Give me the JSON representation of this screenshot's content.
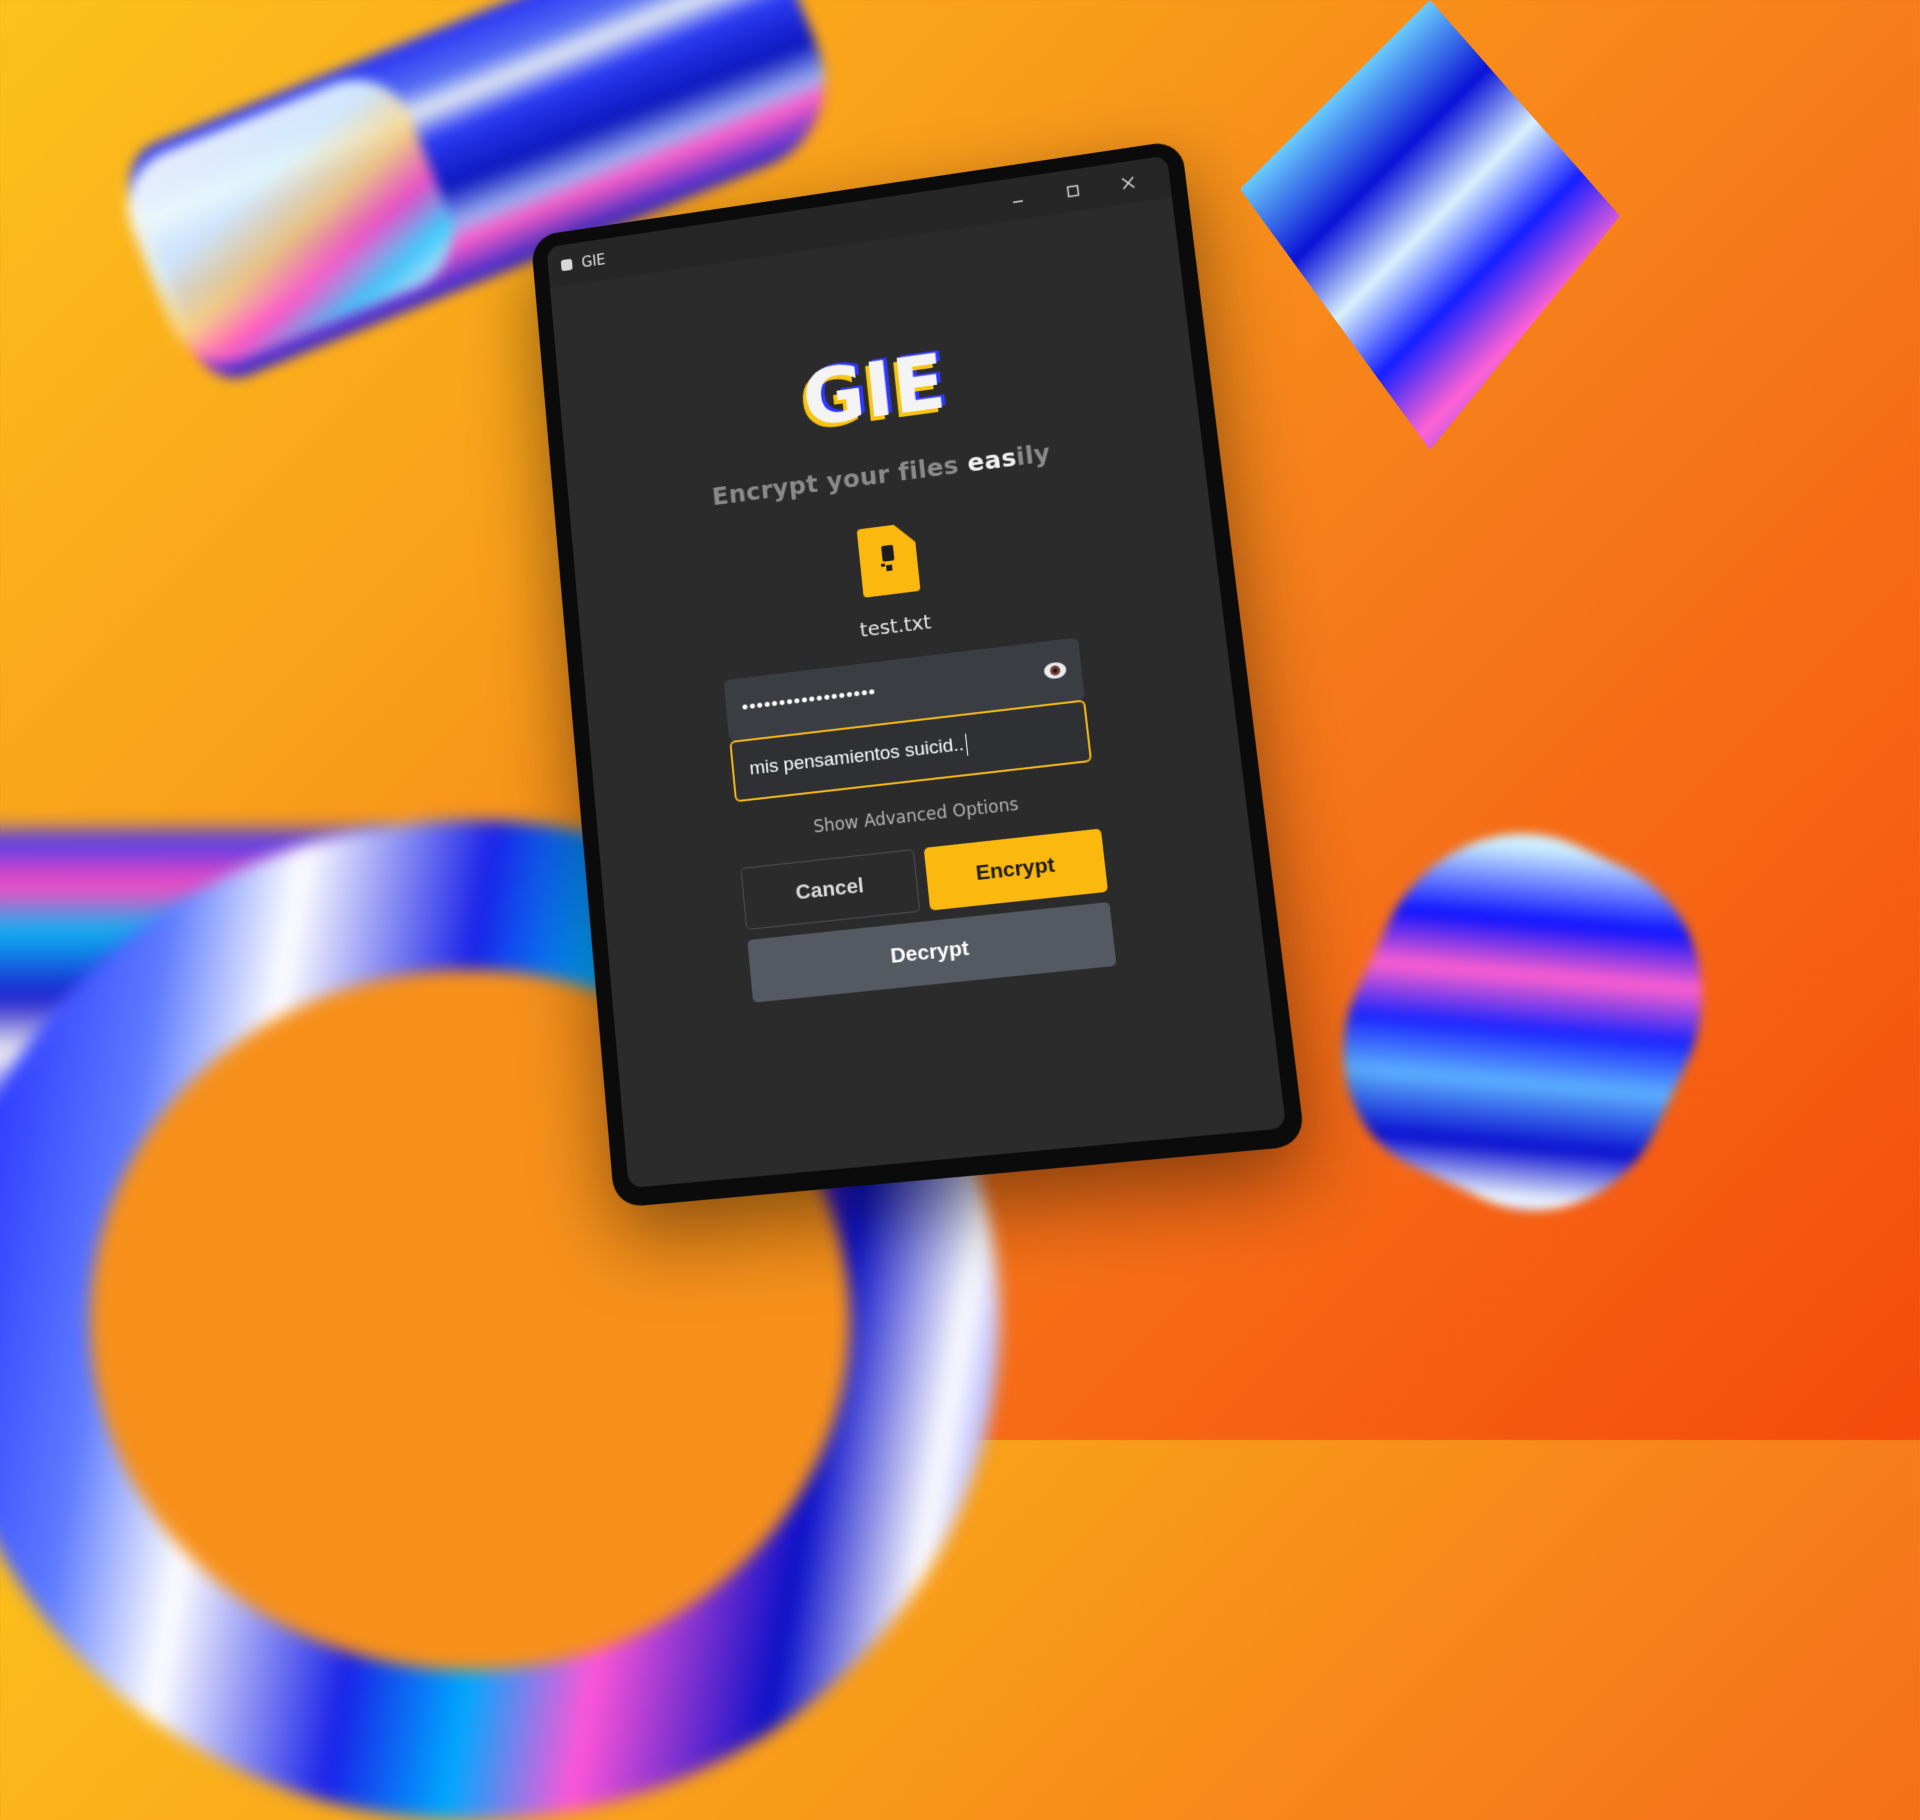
{
  "window": {
    "title": "GIE",
    "controls": [
      "minimize-icon",
      "maximize-icon",
      "close-icon"
    ]
  },
  "brand": {
    "logo_text": "GIE",
    "tagline_prefix": "Encrypt your files ",
    "tagline_highlight": "eas",
    "tagline_suffix": "ily"
  },
  "file": {
    "icon": "locked-file-icon",
    "name": "test.txt"
  },
  "form": {
    "password_mask": "••••••••••••••••••",
    "password_toggle_icon": "eye-icon",
    "hint_value": "mis pensamientos suicid.."
  },
  "actions": {
    "advanced_label": "Show Advanced Options",
    "cancel_label": "Cancel",
    "encrypt_label": "Encrypt",
    "decrypt_label": "Decrypt"
  },
  "colors": {
    "accent": "#fbb90f",
    "window_bg": "#2b2b2c",
    "field_bg": "#3a3d42",
    "decrypt_bg": "#555a62"
  }
}
